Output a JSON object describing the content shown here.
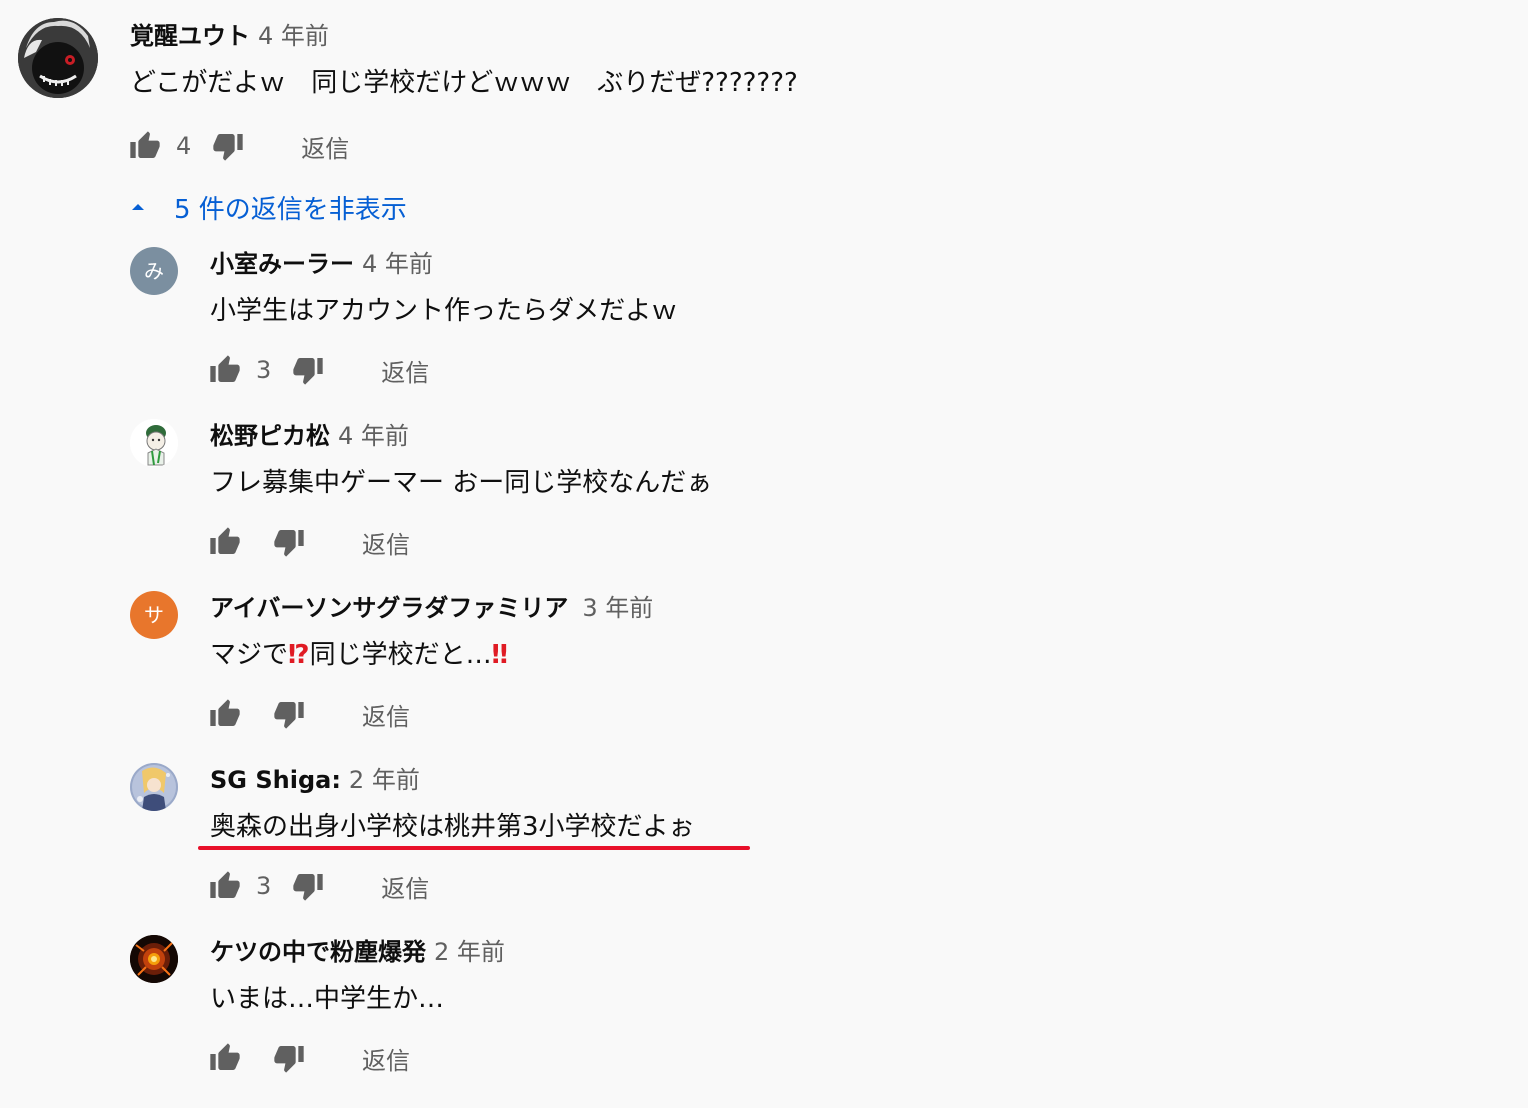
{
  "top_comment": {
    "author": "覚醒ユウト",
    "time": "4 年前",
    "text": "どこがだよｗ　同じ学校だけどｗｗｗ　ぶりだぜ???????",
    "likes": "4",
    "reply_label": "返信"
  },
  "replies_toggle": {
    "label": "5 件の返信を非表示"
  },
  "replies": [
    {
      "author": "小室みーラー",
      "time": "4 年前",
      "text": "小学生はアカウント作ったらダメだよｗ",
      "likes": "3",
      "reply_label": "返信",
      "avatar_letter": "み",
      "avatar_color": "#7b8fa0"
    },
    {
      "author": "松野ピカ松",
      "time": "4 年前",
      "text": "フレ募集中ゲーマー おー同じ学校なんだぁ",
      "likes": "",
      "reply_label": "返信"
    },
    {
      "author": "アイバーソンサグラダファミリア",
      "time": "3 年前",
      "text_prefix": "マジで",
      "emoji1": "⁉",
      "text_middle": "同じ学校だと…",
      "emoji2": "‼",
      "likes": "",
      "reply_label": "返信",
      "avatar_letter": "サ",
      "avatar_color": "#e8762c"
    },
    {
      "author": "SG Shiga:",
      "time": "2 年前",
      "text": "奥森の出身小学校は桃井第3小学校だよぉ",
      "likes": "3",
      "reply_label": "返信"
    },
    {
      "author": "ケツの中で粉塵爆発",
      "time": "2 年前",
      "text": "いまは…中学生か…",
      "likes": "",
      "reply_label": "返信"
    }
  ],
  "colors": {
    "background": "#f9f9f9",
    "link_blue": "#065fd4",
    "secondary_text": "#606060",
    "highlight_red": "#e8102a"
  }
}
